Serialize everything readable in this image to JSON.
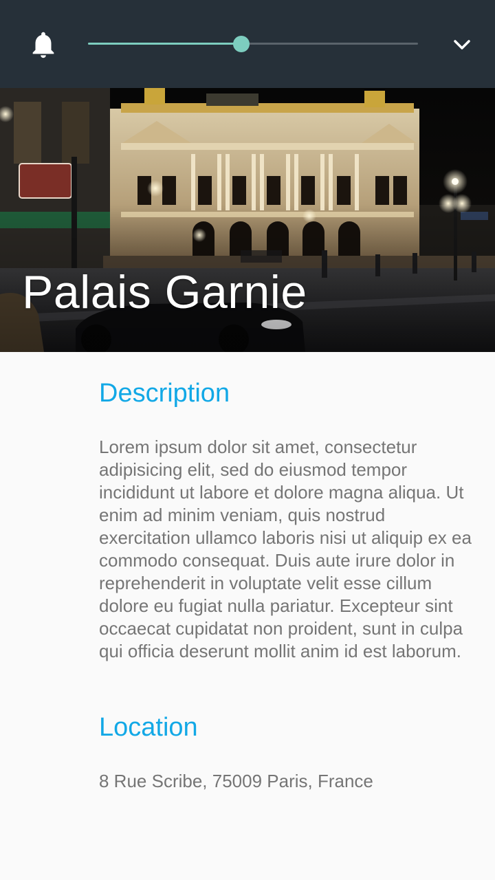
{
  "app_bar": {
    "bell_icon": "bell-icon",
    "slider_value": 0.465,
    "dropdown_icon": "chevron-down-icon",
    "accent_color": "#7dcdbf",
    "background_color": "#263039"
  },
  "hero": {
    "title": "Palais Garnie",
    "image": "night photo of the Palais Garnier opera house with street lights, a car and the 'Boulevard des Capucines' street sign"
  },
  "description": {
    "heading": "Description",
    "text": "Lorem ipsum dolor sit amet, consectetur adipisicing elit, sed do eiusmod tempor incididunt ut labore et dolore magna aliqua. Ut enim ad minim veniam, quis nostrud exercitation ullamco laboris nisi ut aliquip ex ea commodo consequat. Duis aute irure dolor in reprehenderit in voluptate velit esse cillum dolore eu fugiat nulla pariatur. Excepteur sint occaecat cupidatat non proident, sunt in culpa qui officia deserunt mollit anim id est laborum."
  },
  "location": {
    "heading": "Location",
    "address": "8 Rue Scribe, 75009 Paris, France"
  },
  "colors": {
    "heading": "#12a8e6",
    "body_text": "#757575",
    "page_background": "#fafafa"
  }
}
